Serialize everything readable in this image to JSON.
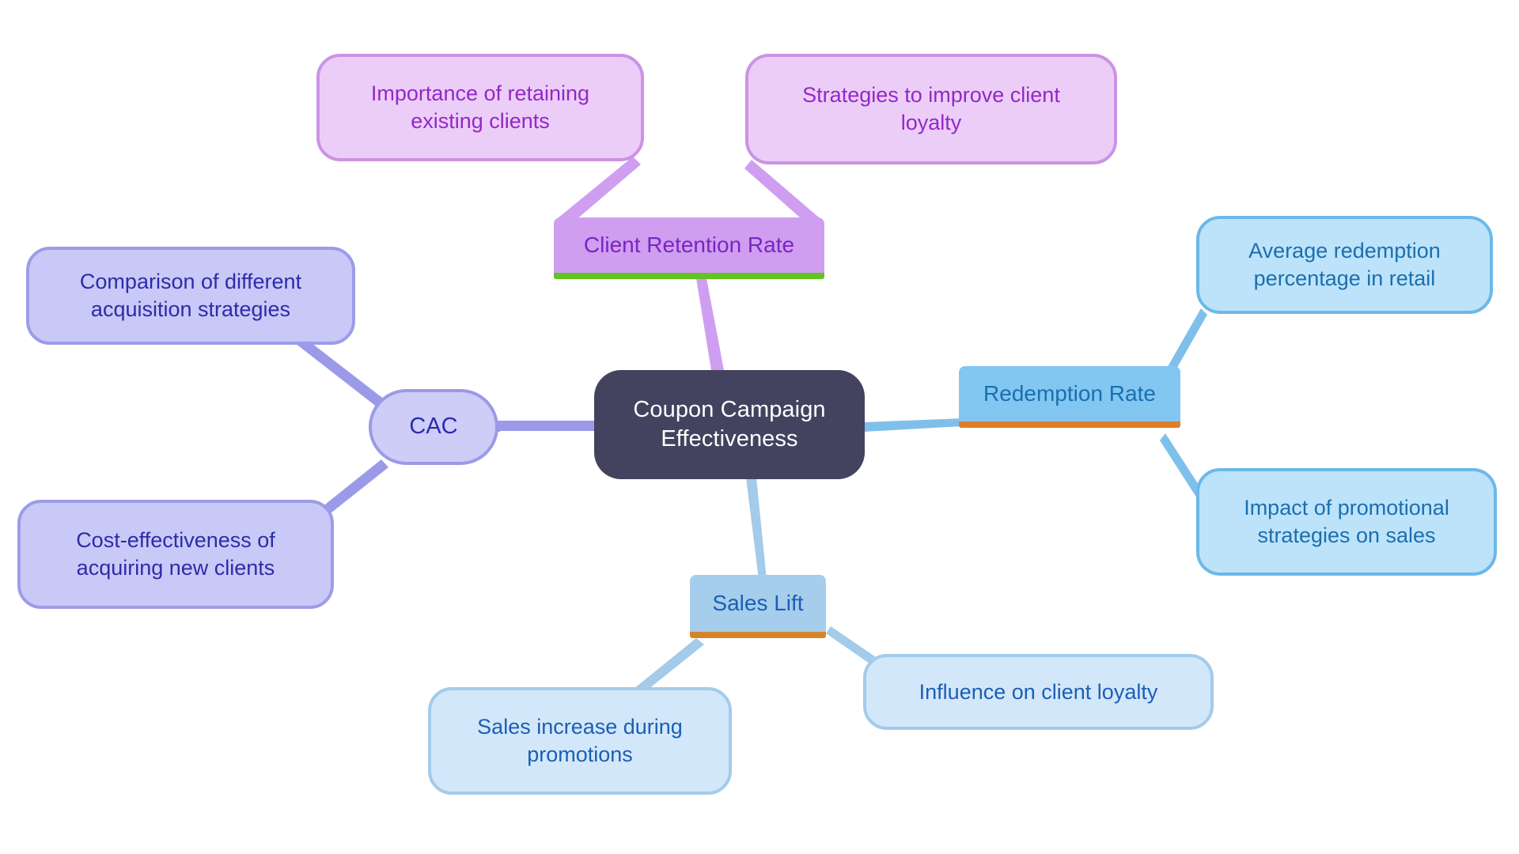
{
  "diagram": {
    "type": "mindmap",
    "title": "Coupon Campaign Effectiveness",
    "background": "#ffffff",
    "root": {
      "id": "root",
      "label": "Coupon Campaign\nEffectiveness",
      "fill": "#434360",
      "text_color": "#ffffff"
    },
    "branches": [
      {
        "id": "client-retention-rate",
        "label": "Client Retention Rate",
        "fill": "#cf9ef0",
        "text_color": "#7b24c4",
        "accent": "#64c223",
        "edge_color": "#cf9ef0",
        "children": [
          {
            "id": "importance-retaining-existing-clients",
            "label": "Importance of retaining\nexisting clients",
            "fill": "#eccdf8",
            "border": "#cb93e4",
            "text_color": "#9328c8"
          },
          {
            "id": "strategies-improve-client-loyalty",
            "label": "Strategies to improve client\nloyalty",
            "fill": "#eccdf8",
            "border": "#cb93e4",
            "text_color": "#9328c8"
          }
        ]
      },
      {
        "id": "cac",
        "label": "CAC",
        "fill": "#cdcdf7",
        "text_color": "#2b2bb0",
        "accent": "#9a9ae8",
        "edge_color": "#9a9ae8",
        "children": [
          {
            "id": "comparison-acquisition-strategies",
            "label": "Comparison of different\nacquisition strategies",
            "fill": "#c9c9f8",
            "border": "#9c9ce8",
            "text_color": "#2c2ca8"
          },
          {
            "id": "cost-effectiveness-acquiring-new-clients",
            "label": "Cost-effectiveness of\nacquiring new clients",
            "fill": "#c9c9f8",
            "border": "#9c9ce8",
            "text_color": "#2c2ca8"
          }
        ]
      },
      {
        "id": "redemption-rate",
        "label": "Redemption Rate",
        "fill": "#82c7f2",
        "text_color": "#1a6fae",
        "accent": "#dc7f28",
        "edge_color": "#7fc0ea",
        "children": [
          {
            "id": "average-redemption-percentage-retail",
            "label": "Average redemption\npercentage in retail",
            "fill": "#bde3fa",
            "border": "#6cb8e8",
            "text_color": "#1b6fae"
          },
          {
            "id": "impact-promotional-strategies-sales",
            "label": "Impact of promotional\nstrategies on sales",
            "fill": "#bde3fa",
            "border": "#6cb8e8",
            "text_color": "#1b6fae"
          }
        ]
      },
      {
        "id": "sales-lift",
        "label": "Sales Lift",
        "fill": "#a6cdec",
        "text_color": "#1b5fb4",
        "accent": "#d4852c",
        "edge_color": "#a4cbe9",
        "children": [
          {
            "id": "sales-increase-during-promotions",
            "label": "Sales increase during\npromotions",
            "fill": "#d3e7fa",
            "border": "#a4cbe9",
            "text_color": "#1b5fb4"
          },
          {
            "id": "influence-client-loyalty",
            "label": "Influence on client loyalty",
            "fill": "#d3e7fa",
            "border": "#a4cbe9",
            "text_color": "#1b5fb4"
          }
        ]
      }
    ]
  }
}
